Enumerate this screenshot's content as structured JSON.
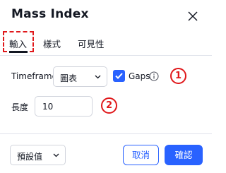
{
  "dialog": {
    "title": "Mass Index"
  },
  "tabs": [
    {
      "label": "輸入",
      "active": true
    },
    {
      "label": "樣式",
      "active": false
    },
    {
      "label": "可見性",
      "active": false
    }
  ],
  "inputs": {
    "timeframe_label": "Timeframe",
    "timeframe_value": "圖表",
    "gaps_label": "Gaps",
    "gaps_checked": true,
    "length_label": "長度",
    "length_value": "10"
  },
  "annotations": {
    "marker_1": "1",
    "marker_2": "2"
  },
  "footer": {
    "defaults_label": "預設值",
    "cancel_label": "取消",
    "ok_label": "確認"
  },
  "colors": {
    "accent": "#2962ff",
    "annotation_red": "#e0181b"
  },
  "icons": [
    "close-icon",
    "chevron-down-icon",
    "check-icon",
    "info-icon"
  ]
}
